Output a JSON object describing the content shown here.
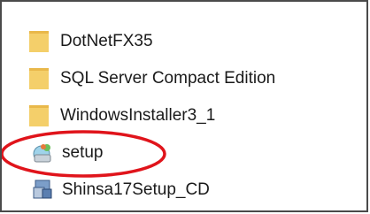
{
  "files": [
    {
      "name": "DotNetFX35",
      "icon": "folder-icon"
    },
    {
      "name": "SQL Server Compact Edition",
      "icon": "folder-icon"
    },
    {
      "name": "WindowsInstaller3_1",
      "icon": "folder-icon"
    },
    {
      "name": "setup",
      "icon": "setup-icon"
    },
    {
      "name": "Shinsa17Setup_CD",
      "icon": "installer-icon"
    }
  ],
  "annotation": {
    "color": "#e0141b",
    "target": "setup"
  },
  "colors": {
    "folder": "#f4cf6a",
    "folder_shade": "#e9b84a",
    "frame": "#4a4a4a"
  }
}
